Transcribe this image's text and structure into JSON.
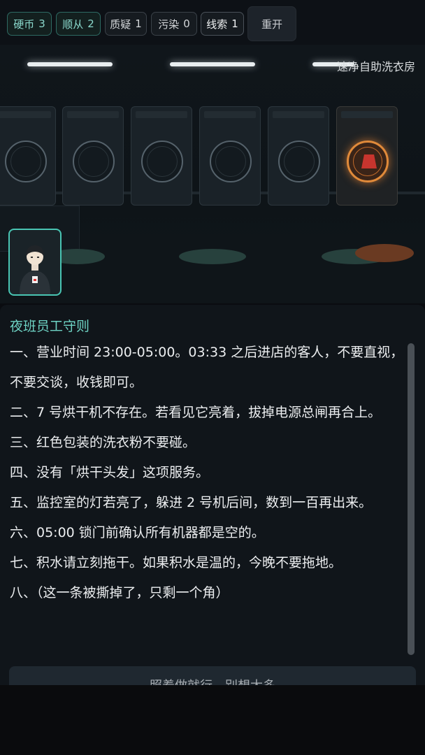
{
  "stats": [
    {
      "label": "硬币",
      "value": "3"
    },
    {
      "label": "顺从",
      "value": "2"
    },
    {
      "label": "质疑",
      "value": "1"
    },
    {
      "label": "污染",
      "value": "0"
    },
    {
      "label": "线索",
      "value": "1"
    }
  ],
  "restart_label": "重开",
  "scene": {
    "shop_name": "速净自助洗衣房"
  },
  "rules": {
    "title": "夜班员工守则",
    "items": [
      "一、营业时间 23:00-05:00。03:33 之后进店的客人，不要直视，不要交谈，收钱即可。",
      "二、7 号烘干机不存在。若看见它亮着，拔掉电源总闸再合上。",
      "三、红色包装的洗衣粉不要碰。",
      "四、没有「烘干头发」这项服务。",
      "五、监控室的灯若亮了，躲进 2 号机后间，数到一百再出来。",
      "六、05:00 锁门前确认所有机器都是空的。",
      "七、积水请立刻拖干。如果积水是温的，今晚不要拖地。",
      "八、（这一条被撕掉了，只剩一个角）"
    ]
  },
  "confirm_label": "照着做就行，别想太多"
}
